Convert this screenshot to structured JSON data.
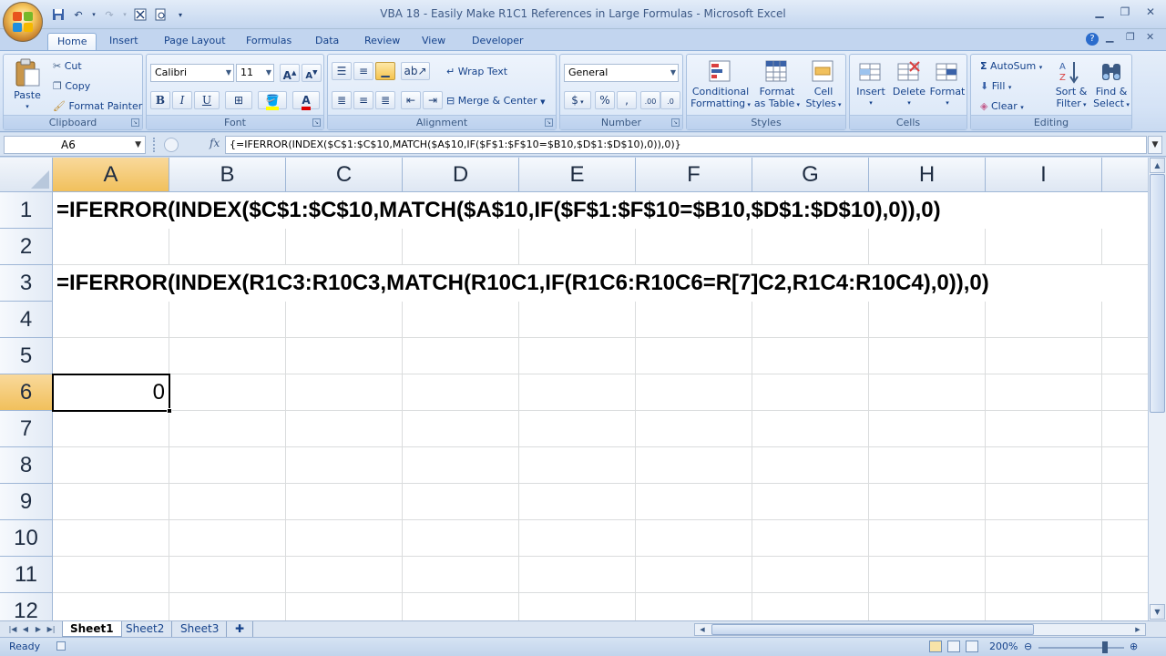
{
  "window": {
    "title": "VBA 18 - Easily Make R1C1 References in Large Formulas - Microsoft Excel"
  },
  "tabs": [
    "Home",
    "Insert",
    "Page Layout",
    "Formulas",
    "Data",
    "Review",
    "View",
    "Developer"
  ],
  "active_tab": "Home",
  "clipboard": {
    "paste": "Paste",
    "cut": "Cut",
    "copy": "Copy",
    "format_painter": "Format Painter",
    "label": "Clipboard"
  },
  "font": {
    "name": "Calibri",
    "size": "11",
    "label": "Font",
    "bold": "B",
    "italic": "I",
    "underline": "U",
    "font_color_glyph": "A"
  },
  "alignment": {
    "wrap_text": "Wrap Text",
    "merge_center": "Merge & Center",
    "label": "Alignment"
  },
  "number": {
    "format": "General",
    "currency": "$",
    "percent": "%",
    "comma": ",",
    "label": "Number"
  },
  "styles": {
    "conditional": "Conditional",
    "formatting": "Formatting",
    "format_as": "Format",
    "as_table": "as Table",
    "cell": "Cell",
    "cell_styles": "Styles",
    "label": "Styles"
  },
  "cells": {
    "insert": "Insert",
    "delete": "Delete",
    "format": "Format",
    "label": "Cells"
  },
  "editing": {
    "autosum": "AutoSum",
    "fill": "Fill",
    "clear": "Clear",
    "sort": "Sort &",
    "filter": "Filter",
    "find": "Find &",
    "select": "Select",
    "label": "Editing"
  },
  "formula_bar": {
    "name_box": "A6",
    "fx": "fx",
    "formula": "{=IFERROR(INDEX($C$1:$C$10,MATCH($A$10,IF($F$1:$F$10=$B10,$D$1:$D$10),0)),0)}"
  },
  "columns": [
    "A",
    "B",
    "C",
    "D",
    "E",
    "F",
    "G",
    "H",
    "I"
  ],
  "selected_column": "A",
  "rows": [
    "1",
    "2",
    "3",
    "4",
    "5",
    "6",
    "7",
    "8",
    "9",
    "10",
    "11",
    "12"
  ],
  "selected_row": "6",
  "cells_content": {
    "r1": "=IFERROR(INDEX($C$1:$C$10,MATCH($A$10,IF($F$1:$F$10=$B10,$D$1:$D$10),0)),0)",
    "r3": "=IFERROR(INDEX(R1C3:R10C3,MATCH(R10C1,IF(R1C6:R10C6=R[7]C2,R1C4:R10C4),0)),0)",
    "a6": "0"
  },
  "sheets": [
    "Sheet1",
    "Sheet2",
    "Sheet3"
  ],
  "active_sheet": "Sheet1",
  "status": {
    "text": "Ready",
    "zoom": "200%"
  },
  "colors": {
    "accent": "#f1c05c",
    "ribbon": "#d5e3f6",
    "grid_line": "#dadcdd"
  }
}
